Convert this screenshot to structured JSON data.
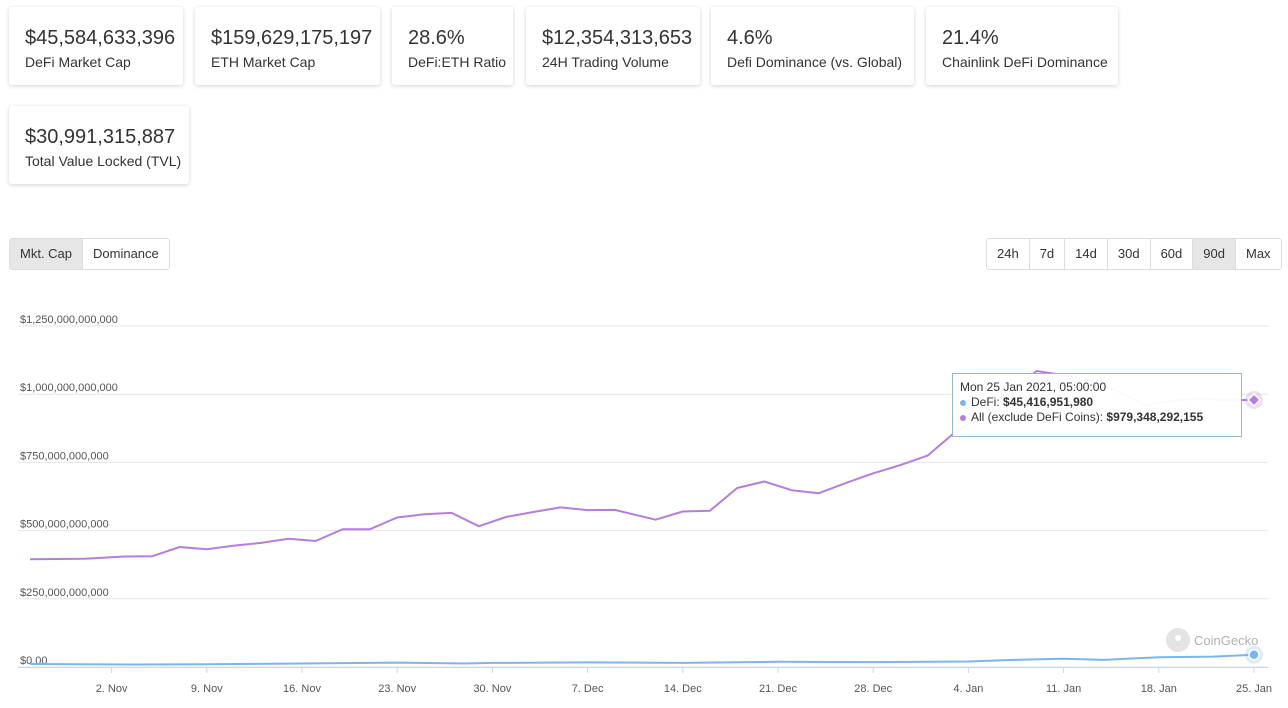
{
  "cards": [
    {
      "value": "$45,584,633,396",
      "label": "DeFi Market Cap"
    },
    {
      "value": "$159,629,175,197",
      "label": "ETH Market Cap"
    },
    {
      "value": "28.6%",
      "label": "DeFi:ETH Ratio"
    },
    {
      "value": "$12,354,313,653",
      "label": "24H Trading Volume"
    },
    {
      "value": "4.6%",
      "label": "Defi Dominance (vs. Global)"
    },
    {
      "value": "21.4%",
      "label": "Chainlink DeFi Dominance"
    },
    {
      "value": "$30,991,315,887",
      "label": "Total Value Locked (TVL)"
    }
  ],
  "view_tabs": [
    {
      "label": "Mkt. Cap",
      "active": true
    },
    {
      "label": "Dominance",
      "active": false
    }
  ],
  "range_tabs": [
    {
      "label": "24h",
      "active": false
    },
    {
      "label": "7d",
      "active": false
    },
    {
      "label": "14d",
      "active": false
    },
    {
      "label": "30d",
      "active": false
    },
    {
      "label": "60d",
      "active": false
    },
    {
      "label": "90d",
      "active": true
    },
    {
      "label": "Max",
      "active": false
    }
  ],
  "tooltip": {
    "date": "Mon 25 Jan 2021, 05:00:00",
    "defi_label": "DeFi:",
    "defi_value": "$45,416,951,980",
    "all_label": "All (exclude DeFi Coins):",
    "all_value": "$979,348,292,155"
  },
  "watermark": "CoinGecko",
  "colors": {
    "defi": "#7cb5ec",
    "all": "#b57edc",
    "grid": "#e6e6e6",
    "active_tab": "#e6e6e6"
  },
  "chart_data": {
    "type": "line",
    "title": "",
    "xlabel": "",
    "ylabel": "",
    "ylim": [
      0,
      1250000000000
    ],
    "yticks": [
      0,
      250000000000,
      500000000000,
      750000000000,
      1000000000000,
      1250000000000
    ],
    "ytick_labels": [
      "$0.00",
      "$250,000,000,000",
      "$500,000,000,000",
      "$750,000,000,000",
      "$1,000,000,000,000",
      "$1,250,000,000,000"
    ],
    "x_start": "2020-10-27",
    "xticks": [
      "2020-11-02",
      "2020-11-09",
      "2020-11-16",
      "2020-11-23",
      "2020-11-30",
      "2020-12-07",
      "2020-12-14",
      "2020-12-21",
      "2020-12-28",
      "2021-01-04",
      "2021-01-11",
      "2021-01-18",
      "2021-01-25"
    ],
    "xtick_labels": [
      "2. Nov",
      "9. Nov",
      "16. Nov",
      "23. Nov",
      "30. Nov",
      "7. Dec",
      "14. Dec",
      "21. Dec",
      "28. Dec",
      "4. Jan",
      "11. Jan",
      "18. Jan",
      "25. Jan"
    ],
    "x_end": "2021-01-25",
    "grid": true,
    "series": [
      {
        "name": "All (exclude DeFi Coins)",
        "color": "#b57edc",
        "x": [
          "2020-10-27",
          "2020-10-31",
          "2020-11-03",
          "2020-11-05",
          "2020-11-07",
          "2020-11-09",
          "2020-11-11",
          "2020-11-13",
          "2020-11-15",
          "2020-11-17",
          "2020-11-19",
          "2020-11-21",
          "2020-11-23",
          "2020-11-25",
          "2020-11-27",
          "2020-11-29",
          "2020-12-01",
          "2020-12-03",
          "2020-12-05",
          "2020-12-07",
          "2020-12-09",
          "2020-12-12",
          "2020-12-14",
          "2020-12-16",
          "2020-12-18",
          "2020-12-20",
          "2020-12-22",
          "2020-12-24",
          "2020-12-26",
          "2020-12-28",
          "2020-12-30",
          "2021-01-01",
          "2021-01-03",
          "2021-01-05",
          "2021-01-07",
          "2021-01-09",
          "2021-01-11",
          "2021-01-13",
          "2021-01-15",
          "2021-01-17",
          "2021-01-19",
          "2021-01-21",
          "2021-01-23",
          "2021-01-25"
        ],
        "values": [
          395000000000.0,
          397000000000.0,
          405000000000.0,
          406000000000.0,
          440000000000.0,
          432000000000.0,
          445000000000.0,
          455000000000.0,
          470000000000.0,
          462000000000.0,
          505000000000.0,
          505000000000.0,
          548000000000.0,
          560000000000.0,
          565000000000.0,
          516000000000.0,
          550000000000.0,
          568000000000.0,
          585000000000.0,
          575000000000.0,
          576000000000.0,
          540000000000.0,
          570000000000.0,
          573000000000.0,
          656000000000.0,
          680000000000.0,
          648000000000.0,
          637000000000.0,
          675000000000.0,
          710000000000.0,
          740000000000.0,
          775000000000.0,
          860000000000.0,
          920000000000.0,
          1000000000000.0,
          1085000000000.0,
          1070000000000.0,
          1050000000000.0,
          1010000000000.0,
          960000000000.0,
          975000000000.0,
          985000000000.0,
          978000000000.0,
          979000000000.0
        ]
      },
      {
        "name": "DeFi",
        "color": "#7cb5ec",
        "x": [
          "2020-10-27",
          "2020-11-04",
          "2020-11-09",
          "2020-11-16",
          "2020-11-23",
          "2020-11-28",
          "2020-11-30",
          "2020-12-07",
          "2020-12-14",
          "2020-12-21",
          "2020-12-28",
          "2021-01-04",
          "2021-01-08",
          "2021-01-11",
          "2021-01-14",
          "2021-01-18",
          "2021-01-22",
          "2021-01-25"
        ],
        "values": [
          11000000000.0,
          9000000000.0,
          10000000000.0,
          13000000000.0,
          16000000000.0,
          13000000000.0,
          15000000000.0,
          17000000000.0,
          15000000000.0,
          19000000000.0,
          18000000000.0,
          20000000000.0,
          27000000000.0,
          30000000000.0,
          26000000000.0,
          36000000000.0,
          38000000000.0,
          45000000000.0
        ]
      }
    ]
  }
}
